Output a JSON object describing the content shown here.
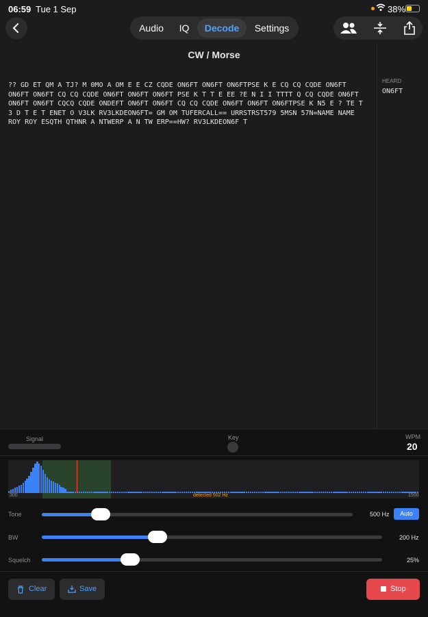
{
  "status": {
    "time": "06:59",
    "date": "Tue 1 Sep",
    "battery": "38%"
  },
  "tabs": [
    {
      "label": "Audio",
      "active": false
    },
    {
      "label": "IQ",
      "active": false
    },
    {
      "label": "Decode",
      "active": true
    },
    {
      "label": "Settings",
      "active": false
    }
  ],
  "page": {
    "title": "CW / Morse"
  },
  "decoded_text": "?? GD ET QM A TJ? M 0MO A OM E E CZ CQDE ON6FT ON6FT ON6FTPSE K E CQ CQ CQDE ON6FT ON6FT ON6FT CQ CQ CQDE ON6FT ON6FT ON6FT PSE K T T E EE ?E N I I TTTT Q CQ CQDE ON6FT ON6FT ON6FT CQCQ CQDE ONDEFT ON6FT ON6FT CQ CQ CQDE ON6FT ON6FT ON6FTPSE K N5 E ? TE T 3 D T E T ENET O V3LK RV3LKDEON6FT= GM OM TUFERCALL== URRSTRST579 5MSN 57N=NAME NAME ROY ROY ESQTH QTHNR A NTWERP A N TW ERP==HW? RV3LKDEON6F T",
  "heard": {
    "label": "HEARD",
    "items": [
      "ON6FT"
    ]
  },
  "meters": {
    "signal_label": "Signal",
    "key_label": "Key",
    "wpm_label": "WPM",
    "wpm_value": "20"
  },
  "spectrum": {
    "min_label": "300",
    "max_label": "1500",
    "detected_label": "detected 502 Hz",
    "bars": [
      2,
      3,
      4,
      5,
      6,
      7,
      8,
      10,
      12,
      14,
      16,
      20,
      24,
      28,
      30,
      28,
      26,
      22,
      18,
      15,
      13,
      12,
      11,
      10,
      9,
      8,
      6,
      5,
      4,
      1,
      1,
      1,
      1,
      1,
      1,
      1,
      1,
      1,
      1,
      1,
      1,
      1,
      1,
      1,
      1,
      1,
      1,
      1,
      1,
      1,
      1,
      1,
      1,
      1,
      1,
      1,
      1,
      1,
      1,
      1,
      1,
      1,
      1,
      1,
      1,
      1,
      1,
      1,
      1,
      1,
      1,
      1,
      1,
      1,
      1,
      1,
      1,
      1,
      1,
      1,
      1,
      1,
      1,
      1,
      1,
      1,
      1,
      1,
      1,
      1,
      1,
      1,
      1,
      1,
      1,
      1,
      1,
      1,
      1,
      1,
      1,
      1,
      1,
      1,
      1,
      1,
      1,
      1,
      1,
      1,
      1,
      1,
      1,
      1,
      1,
      1,
      1,
      1,
      1,
      1,
      1,
      1,
      1,
      1,
      1,
      1,
      1,
      1,
      1,
      1,
      1,
      1,
      1,
      1,
      1,
      1,
      1,
      1,
      1,
      1,
      1,
      1,
      1,
      1,
      1,
      1,
      1,
      1,
      1,
      1,
      1,
      1,
      1,
      1,
      1,
      1,
      1,
      1,
      1,
      1,
      1,
      1,
      1,
      1,
      1,
      1,
      1,
      1,
      1,
      1,
      1,
      1,
      1,
      1,
      1,
      1,
      1,
      1,
      1,
      1,
      1,
      1,
      1,
      1,
      1,
      1,
      1,
      1,
      1,
      1,
      1,
      1,
      1,
      1,
      1,
      1,
      1,
      1,
      1,
      1,
      1,
      1,
      1,
      1
    ]
  },
  "controls": {
    "tone": {
      "label": "Tone",
      "value": "500 Hz",
      "auto_label": "Auto",
      "level": 0.19
    },
    "bw": {
      "label": "BW",
      "value": "200 Hz",
      "level": 0.34
    },
    "squelch": {
      "label": "Squelch",
      "value": "25%",
      "level": 0.26
    }
  },
  "actions": {
    "clear": "Clear",
    "save": "Save",
    "stop": "Stop"
  },
  "colors": {
    "accent": "#3b82f6",
    "stop": "#e5484d"
  }
}
